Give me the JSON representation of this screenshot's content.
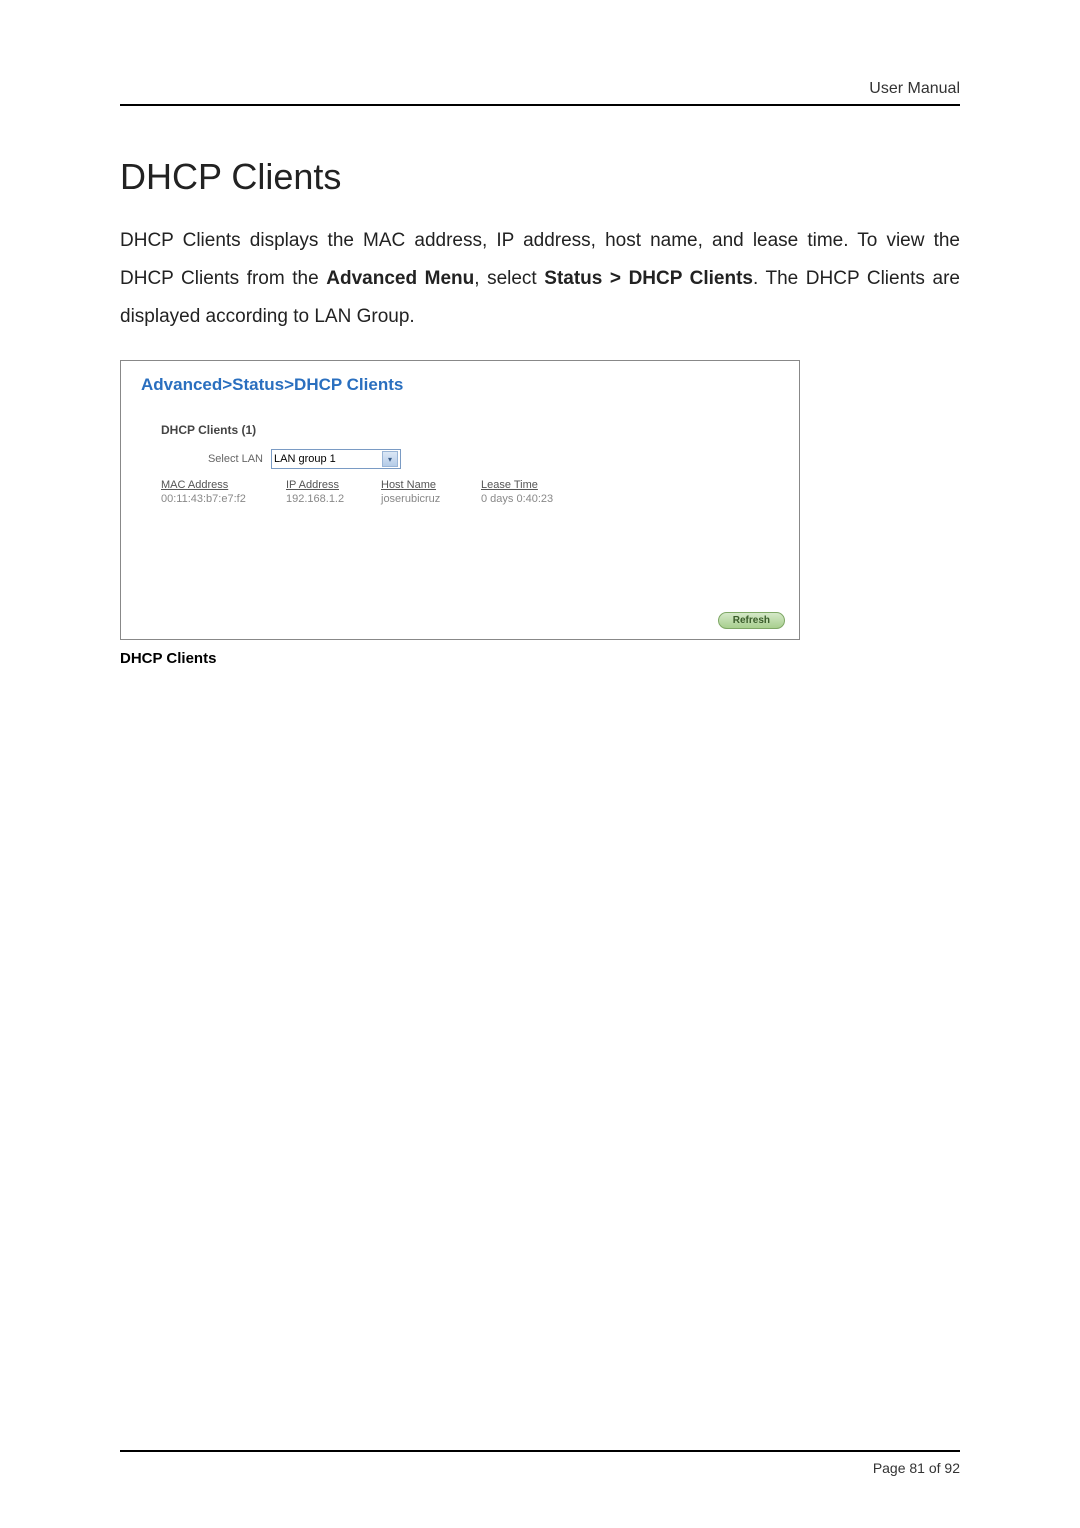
{
  "header": {
    "text": "User Manual"
  },
  "section": {
    "title": "DHCP Clients",
    "para_pre": "DHCP Clients displays the MAC address, IP address, host name, and lease time. To view the DHCP Clients from the ",
    "bold1": "Advanced Menu",
    "mid1": ", select ",
    "bold2": "Status > DHCP Clients",
    "post": ". The DHCP Clients are displayed according to LAN Group."
  },
  "screenshot": {
    "breadcrumb": "Advanced>Status>DHCP Clients",
    "subtitle": "DHCP Clients (1)",
    "select_label": "Select LAN",
    "select_value": "LAN group 1",
    "columns": [
      "MAC Address",
      "IP Address",
      "Host Name",
      "Lease Time"
    ],
    "row": [
      "00:11:43:b7:e7:f2",
      "192.168.1.2",
      "joserubicruz",
      "0 days 0:40:23"
    ],
    "refresh": "Refresh"
  },
  "caption": "DHCP Clients",
  "footer": {
    "text": "Page 81 of 92"
  }
}
